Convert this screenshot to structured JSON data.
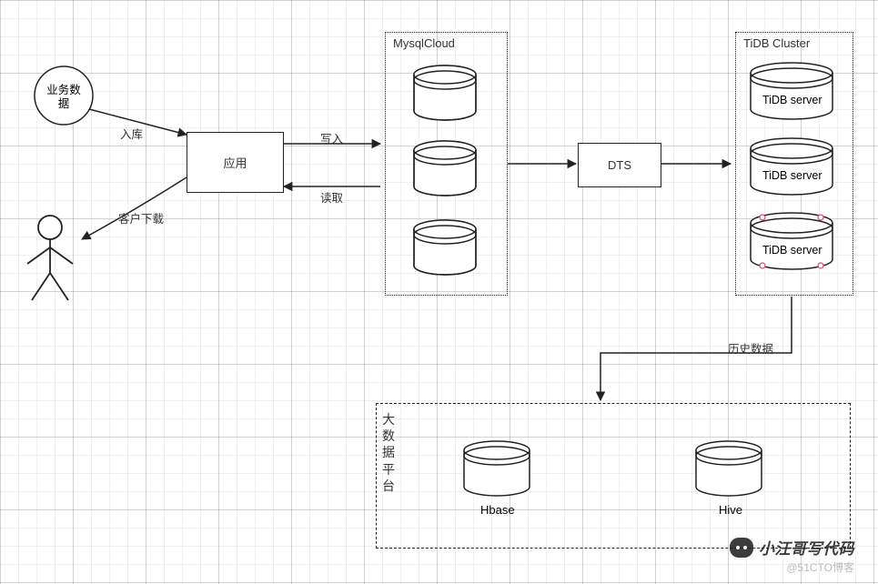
{
  "nodes": {
    "business_data": "业务数\n据",
    "app": "应用",
    "mysql_cloud_label": "MysqlCloud",
    "dts": "DTS",
    "tidb_cluster_label": "TiDB Cluster",
    "tidb_server_a": "TiDB server",
    "tidb_server_b": "TiDB server",
    "tidb_server_c": "TiDB server",
    "big_data_label": "大数据平台",
    "hbase": "Hbase",
    "hive": "Hive"
  },
  "edges": {
    "in_storage": "入库",
    "write": "写入",
    "read": "读取",
    "customer_download": "客户下载",
    "history_data": "历史数据"
  },
  "watermarks": {
    "author": "小汪哥写代码",
    "site": "@51CTO博客"
  }
}
